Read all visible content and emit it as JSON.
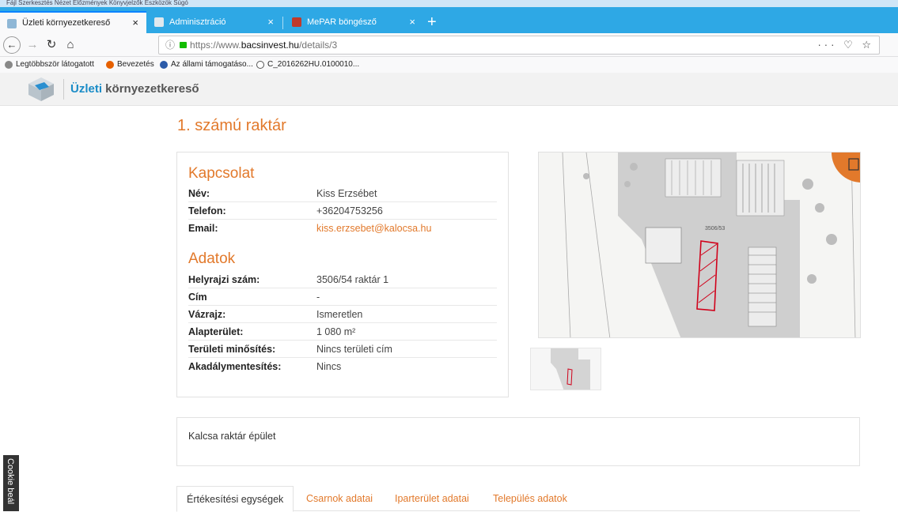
{
  "browser": {
    "menubar_text": "Fájl  Szerkesztés  Nézet  Előzmények  Könyvjelzők  Eszközök  Súgó",
    "tabs": [
      {
        "label": "Üzleti környezetkereső",
        "active": true
      },
      {
        "label": "Adminisztráció",
        "active": false
      },
      {
        "label": "MePAR böngésző",
        "active": false
      }
    ],
    "tab_close": "×",
    "new_tab": "+",
    "url_prefix": "https://www.",
    "url_domain": "bacsinvest.hu",
    "url_path": "/details/3",
    "url_actions": "··· ♡ ☆",
    "bookmarks": [
      {
        "label": "Legtöbbször látogatott",
        "color": "#888888"
      },
      {
        "label": "Bevezetés",
        "color": "#e66000"
      },
      {
        "label": "Az állami támogatáso...",
        "color": "#2b5aa8"
      },
      {
        "label": "C_2016262HU.0100010...",
        "color": "#555555"
      }
    ]
  },
  "site": {
    "brand_highlight": "Üzleti",
    "brand_rest": " környezetkereső"
  },
  "page": {
    "title": "1. számú raktár",
    "contact": {
      "heading": "Kapcsolat",
      "rows": [
        {
          "key": "Név:",
          "value": "Kiss Erzsébet"
        },
        {
          "key": "Telefon:",
          "value": "+36204753256"
        },
        {
          "key": "Email:",
          "value": "kiss.erzsebet@kalocsa.hu"
        }
      ]
    },
    "data": {
      "heading": "Adatok",
      "rows": [
        {
          "key": "Helyrajzi szám:",
          "value": "3506/54 raktár 1"
        },
        {
          "key": "Cím",
          "value": "-"
        },
        {
          "key": "Vázrajz:",
          "value": "Ismeretlen"
        },
        {
          "key": "Alapterület:",
          "value": "1 080 m²"
        },
        {
          "key": "Területi minősítés:",
          "value": "Nincs területi cím"
        },
        {
          "key": "Akadálymentesítés:",
          "value": "Nincs"
        }
      ]
    },
    "map_label": "3506/53",
    "description": "Kalcsa raktár épület",
    "tabs": [
      {
        "label": "Értékesítési egységek",
        "active": true
      },
      {
        "label": "Csarnok adatai",
        "active": false
      },
      {
        "label": "Iparterület adatai",
        "active": false
      },
      {
        "label": "Település adatok",
        "active": false
      }
    ],
    "cookie_label": "Cookie beál"
  },
  "colors": {
    "accent": "#e2792b",
    "browser_tabbar": "#2ea8e5",
    "brand_blue": "#1a8cc7"
  }
}
